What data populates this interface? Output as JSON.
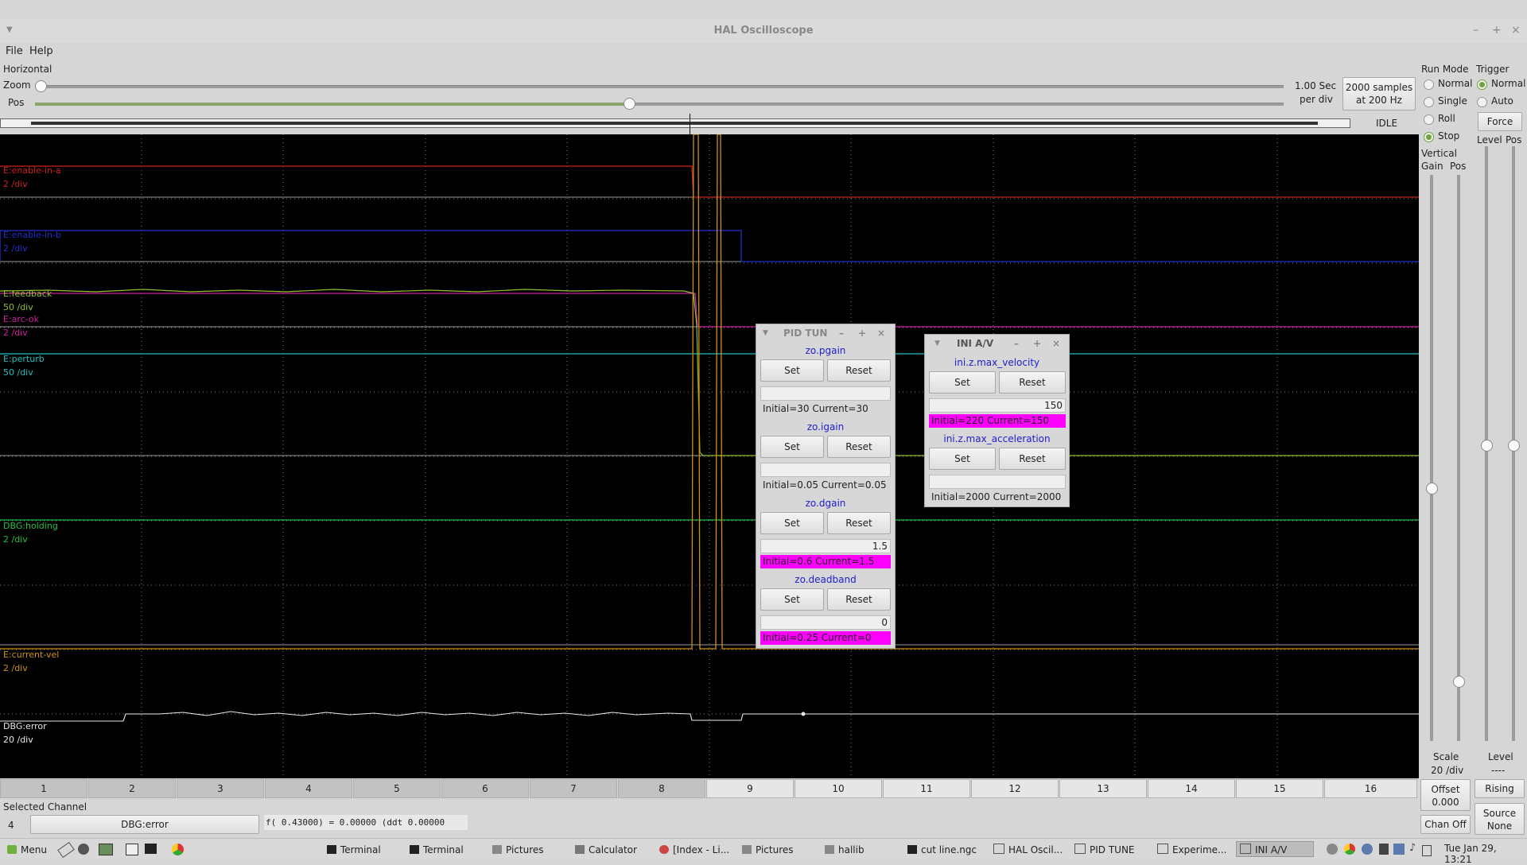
{
  "window": {
    "title": "HAL Oscilloscope",
    "controls": [
      "–",
      "+",
      "×"
    ]
  },
  "menubar": {
    "items": [
      "File",
      "Help"
    ]
  },
  "horizontal": {
    "section_label": "Horizontal",
    "zoom_label": "Zoom",
    "pos_label": "Pos",
    "zoom_value": 0.0,
    "pos_value": 0.47,
    "sec_per_div_1": "1.00 Sec",
    "sec_per_div_2": "per div",
    "samples_1": "2000 samples",
    "samples_2": "at 200 Hz",
    "state": "IDLE"
  },
  "run_mode": {
    "title": "Run Mode",
    "options": [
      "Normal",
      "Single",
      "Roll",
      "Stop"
    ],
    "selected": "Stop"
  },
  "trigger": {
    "title": "Trigger",
    "options": [
      "Normal",
      "Auto"
    ],
    "selected": "Normal",
    "force_label": "Force",
    "level_label": "Level",
    "pos_label": "Pos",
    "level_readout_label": "Level",
    "level_readout_value": "----",
    "edge_button": "Rising",
    "source_button_1": "Source",
    "source_button_2": "None"
  },
  "vertical": {
    "title": "Vertical",
    "gain_label": "Gain",
    "pos_label": "Pos",
    "scale_label": "Scale",
    "scale_value": "20 /div",
    "offset_label": "Offset",
    "offset_value": "0.000",
    "chan_off_label": "Chan Off"
  },
  "traces": [
    {
      "name": "E:enable-in-a",
      "scale": "2 /div",
      "color": "#d02020"
    },
    {
      "name": "E:enable-in-b",
      "scale": "2 /div",
      "color": "#2030d0"
    },
    {
      "name": "E:feedback",
      "scale": "50 /div",
      "color": "#90c030"
    },
    {
      "name": "E:arc-ok",
      "scale": "2 /div",
      "color": "#d020a0"
    },
    {
      "name": "E:perturb",
      "scale": "50 /div",
      "color": "#20c0c0"
    },
    {
      "name": "DBG:holding",
      "scale": "2 /div",
      "color": "#20c040"
    },
    {
      "name": "E:current-vel",
      "scale": "2 /div",
      "color": "#d09010"
    },
    {
      "name": "DBG:error",
      "scale": "20 /div",
      "color": "#e8e8e8"
    }
  ],
  "channels": [
    "1",
    "2",
    "3",
    "4",
    "5",
    "6",
    "7",
    "8",
    "9",
    "10",
    "11",
    "12",
    "13",
    "14",
    "15",
    "16"
  ],
  "selected_channel": {
    "label": "Selected Channel",
    "number": "4",
    "name": "DBG:error",
    "readout": "f( 0.43000) =  0.00000 (ddt  0.00000"
  },
  "pid_tune": {
    "title": "PID TUN",
    "params": [
      {
        "name": "zo.pgain",
        "entry": "",
        "status": "Initial=30 Current=30",
        "changed": false
      },
      {
        "name": "zo.igain",
        "entry": "",
        "status": "Initial=0.05 Current=0.05",
        "changed": false
      },
      {
        "name": "zo.dgain",
        "entry": "1.5",
        "status": "Initial=0.6 Current=1.5",
        "changed": true
      },
      {
        "name": "zo.deadband",
        "entry": "0",
        "status": "Initial=0.25 Current=0",
        "changed": true
      }
    ],
    "set_label": "Set",
    "reset_label": "Reset"
  },
  "ini_av": {
    "title": "INI A/V",
    "params": [
      {
        "name": "ini.z.max_velocity",
        "entry": "150",
        "status": "Initial=220 Current=150",
        "changed": true
      },
      {
        "name": "ini.z.max_acceleration",
        "entry": "",
        "status": "Initial=2000 Current=2000",
        "changed": false
      }
    ],
    "set_label": "Set",
    "reset_label": "Reset"
  },
  "taskbar": {
    "menu_label": "Menu",
    "tasks": [
      "Terminal",
      "Terminal",
      "Pictures",
      "Calculator",
      "[Index - Li...",
      "Pictures",
      "hallib",
      "cut line.ngc",
      "HAL Oscil...",
      "PID TUNE",
      "Experime...",
      "INI A/V"
    ],
    "active_task": "INI A/V",
    "clock": "Tue Jan 29, 13:21"
  }
}
